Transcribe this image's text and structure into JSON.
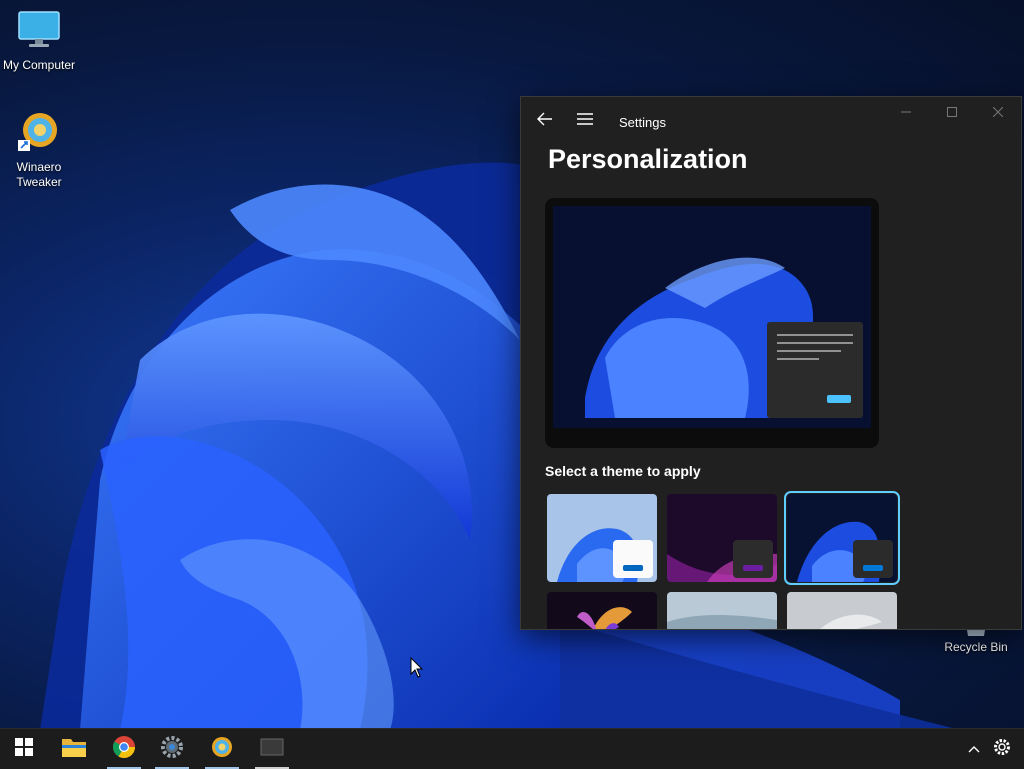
{
  "desktop": {
    "icons": [
      {
        "label": "My Computer",
        "icon": "computer-icon"
      },
      {
        "label": "Winaero\nTweaker",
        "icon": "winaero-icon"
      }
    ],
    "recycle_bin": {
      "label": "Recycle Bin",
      "icon": "recycle-bin-icon"
    }
  },
  "settings": {
    "app_title": "Settings",
    "page_title": "Personalization",
    "section_label": "Select a theme to apply",
    "themes": [
      {
        "name": "light-bloom",
        "selected": false
      },
      {
        "name": "glow",
        "selected": false
      },
      {
        "name": "dark-bloom",
        "selected": true
      },
      {
        "name": "captured-motion",
        "selected": false
      },
      {
        "name": "sunrise",
        "selected": false
      },
      {
        "name": "flow",
        "selected": false
      }
    ],
    "accent_color": "#60cdff"
  },
  "taskbar": {
    "items": [
      "start-icon",
      "file-explorer-icon",
      "chrome-icon",
      "settings-gear-icon",
      "winaero-tweaker-icon",
      "window-thumbnail-icon"
    ],
    "tray": [
      "show-hidden-icons-chevron",
      "settings-tray-icon"
    ]
  }
}
